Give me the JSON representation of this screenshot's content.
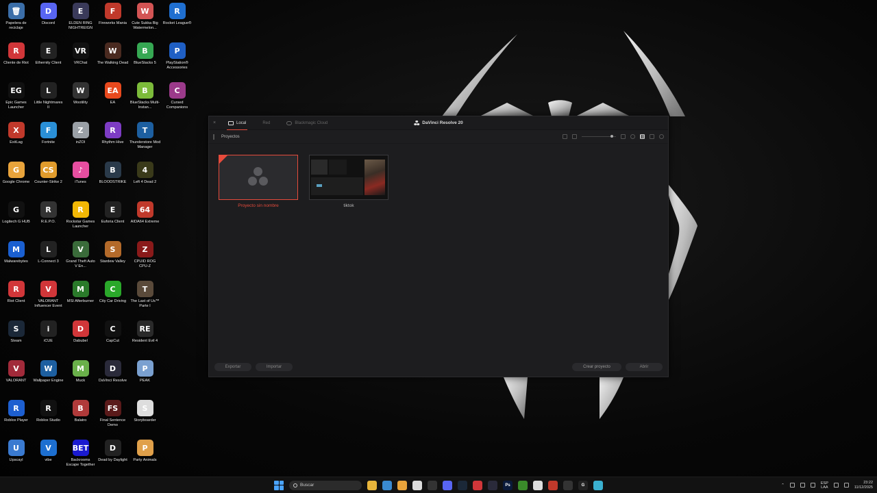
{
  "desktop": {
    "icons": [
      {
        "label": "Papelera de reciclaje",
        "icon": "recycle-bin-icon",
        "color": "#3b6ea8",
        "glyph": "🗑"
      },
      {
        "label": "Discord",
        "icon": "discord-icon",
        "color": "#5865f2",
        "glyph": "D"
      },
      {
        "label": "ELDEN RING NIGHTREIGN",
        "icon": "elden-ring-icon",
        "color": "#3a3a5a",
        "glyph": "E"
      },
      {
        "label": "Fireworks Mania",
        "icon": "fireworks-mania-icon",
        "color": "#c0392b",
        "glyph": "F"
      },
      {
        "label": "Cute Sukka Big Watermelon...",
        "icon": "watermelon-icon",
        "color": "#d35454",
        "glyph": "W"
      },
      {
        "label": "Rocket League®",
        "icon": "rocket-league-icon",
        "color": "#1f6fd0",
        "glyph": "R"
      },
      {
        "label": "Cliente de Riot",
        "icon": "riot-client-icon",
        "color": "#d13639",
        "glyph": "R"
      },
      {
        "label": "Ethernity Client",
        "icon": "ethernity-client-icon",
        "color": "#222",
        "glyph": "E"
      },
      {
        "label": "VRChat",
        "icon": "vrchat-icon",
        "color": "#111",
        "glyph": "VR"
      },
      {
        "label": "The Walking Dead",
        "icon": "walking-dead-icon",
        "color": "#4a2a20",
        "glyph": "W"
      },
      {
        "label": "BlueStacks 5",
        "icon": "bluestacks-icon",
        "color": "#36a853",
        "glyph": "B"
      },
      {
        "label": "PlayStation® Accessories",
        "icon": "playstation-icon",
        "color": "#1f5fc4",
        "glyph": "P"
      },
      {
        "label": "Epic Games Launcher",
        "icon": "epic-games-icon",
        "color": "#111",
        "glyph": "EG"
      },
      {
        "label": "Little Nightmares II",
        "icon": "little-nightmares-icon",
        "color": "#222",
        "glyph": "L"
      },
      {
        "label": "Wootility",
        "icon": "wootility-icon",
        "color": "#333",
        "glyph": "W"
      },
      {
        "label": "EA",
        "icon": "ea-icon",
        "color": "#e8491d",
        "glyph": "EA"
      },
      {
        "label": "BlueStacks Multi-Instan...",
        "icon": "bluestacks-multi-icon",
        "color": "#7cbb3a",
        "glyph": "B"
      },
      {
        "label": "Cursed Companions",
        "icon": "cursed-companions-icon",
        "color": "#9b3a8a",
        "glyph": "C"
      },
      {
        "label": "ExitLag",
        "icon": "exitlag-icon",
        "color": "#c0392b",
        "glyph": "X"
      },
      {
        "label": "Fortnite",
        "icon": "fortnite-icon",
        "color": "#2a8fd6",
        "glyph": "F"
      },
      {
        "label": "inZOI",
        "icon": "inzoi-icon",
        "color": "#9aa0a6",
        "glyph": "Z"
      },
      {
        "label": "Rhythm Hive",
        "icon": "rhythm-hive-icon",
        "color": "#7d3cc4",
        "glyph": "R"
      },
      {
        "label": "Thunderstore Mod Manager",
        "icon": "thunderstore-icon",
        "color": "#1d5fa0",
        "glyph": "T"
      },
      {
        "label": "",
        "icon": "",
        "color": "",
        "glyph": ""
      },
      {
        "label": "Google Chrome",
        "icon": "chrome-icon",
        "color": "#e8a33b",
        "glyph": "G"
      },
      {
        "label": "Counter-Strike 2",
        "icon": "counter-strike-icon",
        "color": "#e09b2c",
        "glyph": "CS"
      },
      {
        "label": "iTunes",
        "icon": "itunes-icon",
        "color": "#e64ea0",
        "glyph": "♪"
      },
      {
        "label": "BLOODSTRIKE",
        "icon": "bloodstrike-icon",
        "color": "#2a3a4a",
        "glyph": "B"
      },
      {
        "label": "Left 4 Dead 2",
        "icon": "left4dead-icon",
        "color": "#3a3a1a",
        "glyph": "4"
      },
      {
        "label": "",
        "icon": "",
        "color": "",
        "glyph": ""
      },
      {
        "label": "Logitech G HUB",
        "icon": "logitech-icon",
        "color": "#111",
        "glyph": "G"
      },
      {
        "label": "R.E.P.O.",
        "icon": "repo-icon",
        "color": "#333",
        "glyph": "R"
      },
      {
        "label": "Rockstar Games Launcher",
        "icon": "rockstar-icon",
        "color": "#f2b705",
        "glyph": "R"
      },
      {
        "label": "Euforia Client",
        "icon": "euforia-icon",
        "color": "#222",
        "glyph": "E"
      },
      {
        "label": "AIDA64 Extreme",
        "icon": "aida64-icon",
        "color": "#c0392b",
        "glyph": "64"
      },
      {
        "label": "",
        "icon": "",
        "color": "",
        "glyph": ""
      },
      {
        "label": "Malwarebytes",
        "icon": "malwarebytes-icon",
        "color": "#1a5fd0",
        "glyph": "M"
      },
      {
        "label": "L-Connect 3",
        "icon": "l-connect-icon",
        "color": "#222",
        "glyph": "L"
      },
      {
        "label": "Grand Theft Auto V En...",
        "icon": "gta-icon",
        "color": "#3a6b3a",
        "glyph": "V"
      },
      {
        "label": "Stardew Valley",
        "icon": "stardew-icon",
        "color": "#b36a2a",
        "glyph": "S"
      },
      {
        "label": "CPUID ROG CPU-Z",
        "icon": "cpuz-icon",
        "color": "#8a1a1a",
        "glyph": "Z"
      },
      {
        "label": "",
        "icon": "",
        "color": "",
        "glyph": ""
      },
      {
        "label": "Riot Client",
        "icon": "riot-client-2-icon",
        "color": "#d13639",
        "glyph": "R"
      },
      {
        "label": "VALORANT Influencer Event",
        "icon": "valorant-event-icon",
        "color": "#d13639",
        "glyph": "V"
      },
      {
        "label": "MSI Afterburner",
        "icon": "afterburner-icon",
        "color": "#2a7a2a",
        "glyph": "M"
      },
      {
        "label": "City Car Driving",
        "icon": "city-car-icon",
        "color": "#2aa82a",
        "glyph": "C"
      },
      {
        "label": "The Last of Us™ Parte I",
        "icon": "last-of-us-icon",
        "color": "#5a4a3a",
        "glyph": "T"
      },
      {
        "label": "",
        "icon": "",
        "color": "",
        "glyph": ""
      },
      {
        "label": "Steam",
        "icon": "steam-icon",
        "color": "#1b2838",
        "glyph": "S"
      },
      {
        "label": "iCUE",
        "icon": "icue-icon",
        "color": "#222",
        "glyph": "i"
      },
      {
        "label": "Dabubel",
        "icon": "dabubel-icon",
        "color": "#d13639",
        "glyph": "D"
      },
      {
        "label": "CapCut",
        "icon": "capcut-icon",
        "color": "#111",
        "glyph": "C"
      },
      {
        "label": "Resident Evil 4",
        "icon": "resident-evil-icon",
        "color": "#2a2a2a",
        "glyph": "RE"
      },
      {
        "label": "",
        "icon": "",
        "color": "",
        "glyph": ""
      },
      {
        "label": "VALORANT",
        "icon": "valorant-icon",
        "color": "#a12a3a",
        "glyph": "V"
      },
      {
        "label": "Wallpaper Engine",
        "icon": "wallpaper-engine-icon",
        "color": "#1d5fa0",
        "glyph": "W"
      },
      {
        "label": "Muck",
        "icon": "muck-icon",
        "color": "#6ab04a",
        "glyph": "M"
      },
      {
        "label": "DaVinci Resolve",
        "icon": "davinci-resolve-icon",
        "color": "#2a2a3a",
        "glyph": "D"
      },
      {
        "label": "PEAK",
        "icon": "peak-icon",
        "color": "#7aa0d0",
        "glyph": "P"
      },
      {
        "label": "",
        "icon": "",
        "color": "",
        "glyph": ""
      },
      {
        "label": "Roblox Player",
        "icon": "roblox-player-icon",
        "color": "#1d5fd0",
        "glyph": "R"
      },
      {
        "label": "Roblox Studio",
        "icon": "roblox-studio-icon",
        "color": "#111",
        "glyph": "R"
      },
      {
        "label": "Balatro",
        "icon": "balatro-icon",
        "color": "#b03a3a",
        "glyph": "B"
      },
      {
        "label": "Final Sentence Demo",
        "icon": "final-sentence-icon",
        "color": "#5a1a1a",
        "glyph": "FS"
      },
      {
        "label": "Storyboarder",
        "icon": "storyboarder-icon",
        "color": "#ddd",
        "glyph": "S"
      },
      {
        "label": "",
        "icon": "",
        "color": "",
        "glyph": ""
      },
      {
        "label": "Upscayl",
        "icon": "upscayl-icon",
        "color": "#3a7ad0",
        "glyph": "U"
      },
      {
        "label": "vibe",
        "icon": "vibe-icon",
        "color": "#1d6fd0",
        "glyph": "V"
      },
      {
        "label": "Backrooms Escape Together",
        "icon": "backrooms-icon",
        "color": "#1a1ad0",
        "glyph": "BET"
      },
      {
        "label": "Dead by Daylight",
        "icon": "dead-by-daylight-icon",
        "color": "#222",
        "glyph": "D"
      },
      {
        "label": "Party Animals",
        "icon": "party-animals-icon",
        "color": "#e0a04a",
        "glyph": "P"
      },
      {
        "label": "",
        "icon": "",
        "color": "",
        "glyph": ""
      }
    ]
  },
  "davinci": {
    "close": "×",
    "tabs": [
      {
        "label": "Local",
        "active": true
      },
      {
        "label": "Red",
        "active": false
      },
      {
        "label": "Blackmagic Cloud",
        "active": false
      }
    ],
    "title": "DaVinci Resolve 20",
    "breadcrumb": "Proyectos",
    "projects": [
      {
        "name": "Proyecto sin nombre",
        "selected": true
      },
      {
        "name": "tiktok",
        "selected": false
      }
    ],
    "buttons": {
      "export": "Exportar",
      "import": "Importar",
      "create": "Crear proyecto",
      "open": "Abrir"
    },
    "accent": "#e64b3c"
  },
  "taskbar": {
    "search_placeholder": "Buscar",
    "apps": [
      {
        "icon": "file-explorer-icon",
        "color": "#e8b53b",
        "glyph": ""
      },
      {
        "icon": "photos-icon",
        "color": "#3a8ad0",
        "glyph": ""
      },
      {
        "icon": "chrome-icon",
        "color": "#e8a33b",
        "glyph": ""
      },
      {
        "icon": "store-icon",
        "color": "#ddd",
        "glyph": ""
      },
      {
        "icon": "keyboard-icon",
        "color": "#333",
        "glyph": ""
      },
      {
        "icon": "discord-icon",
        "color": "#5865f2",
        "glyph": ""
      },
      {
        "icon": "steam-icon",
        "color": "#1b2838",
        "glyph": ""
      },
      {
        "icon": "riot-icon",
        "color": "#d13639",
        "glyph": ""
      },
      {
        "icon": "davinci-icon",
        "color": "#2a2a3a",
        "glyph": ""
      },
      {
        "icon": "photoshop-icon",
        "color": "#0a1a3a",
        "glyph": "Ps"
      },
      {
        "icon": "minecraft-icon",
        "color": "#3a8a2a",
        "glyph": ""
      },
      {
        "icon": "roblox-studio-icon",
        "color": "#ddd",
        "glyph": ""
      },
      {
        "icon": "exitlag-icon",
        "color": "#c0392b",
        "glyph": ""
      },
      {
        "icon": "epic-icon",
        "color": "#333",
        "glyph": ""
      },
      {
        "icon": "logitech-icon",
        "color": "#222",
        "glyph": "G"
      },
      {
        "icon": "notepad-icon",
        "color": "#3ab0d0",
        "glyph": ""
      }
    ],
    "lang_top": "ESP",
    "lang_bottom": "LAA",
    "time": "23:22",
    "date": "11/12/2025"
  }
}
